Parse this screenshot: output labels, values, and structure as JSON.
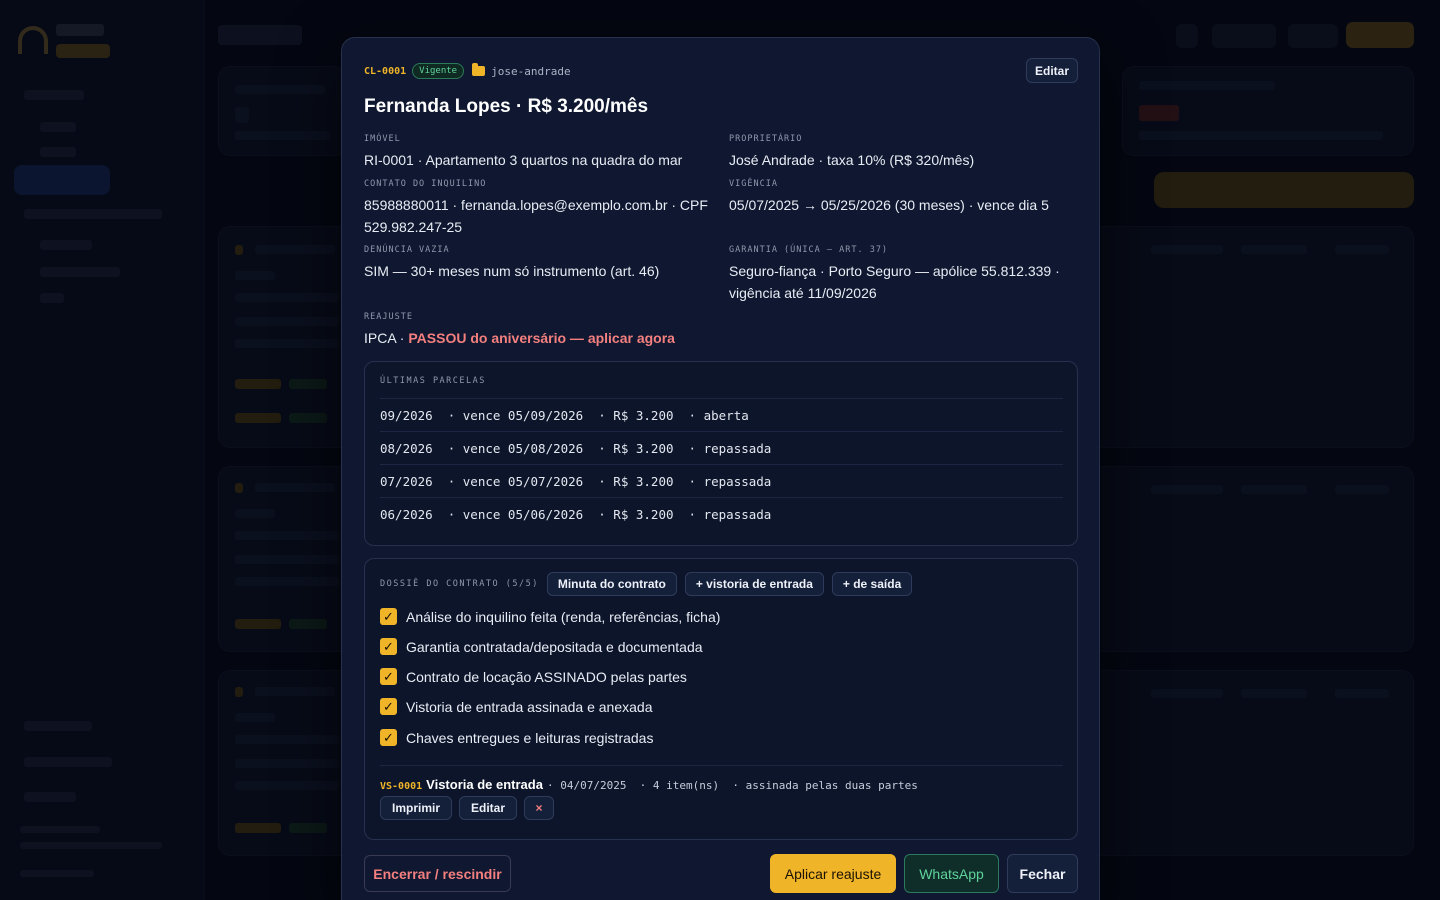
{
  "contract": {
    "code": "CL-0001",
    "status": "Vigente",
    "folder": "jose-andrade",
    "edit_label": "Editar",
    "title": "Fernanda Lopes · R$ 3.200/mês"
  },
  "fields": {
    "imovel": {
      "label": "Imóvel",
      "value": "RI-0001 · Apartamento 3 quartos na quadra do mar"
    },
    "proprietario": {
      "label": "Proprietário",
      "value": "José Andrade · taxa 10% (R$ 320/mês)"
    },
    "contato": {
      "label": "Contato do inquilino",
      "value": "85988880011 · fernanda.lopes@exemplo.com.br · CPF 529.982.247-25"
    },
    "vigencia": {
      "label": "Vigência",
      "value": "05/07/2025 → 05/25/2026 (30 meses) · vence dia 5"
    },
    "denuncia": {
      "label": "Denúncia vazia",
      "value": "SIM — 30+ meses num só instrumento (art. 46)"
    },
    "garantia": {
      "label": "Garantia (única — art. 37)",
      "value": "Seguro-fiança · Porto Seguro — apólice 55.812.339 · vigência até 11/09/2026"
    },
    "reajuste": {
      "label": "Reajuste",
      "value_prefix": "IPCA · ",
      "value_warning": "PASSOU do aniversário — aplicar agora"
    }
  },
  "parcels": {
    "label": "Últimas parcelas",
    "rows": [
      {
        "text": "09/2026  · vence 05/09/2026  · R$ 3.200  · aberta"
      },
      {
        "text": "08/2026  · vence 05/08/2026  · R$ 3.200  · repassada"
      },
      {
        "text": "07/2026  · vence 05/07/2026  · R$ 3.200  · repassada"
      },
      {
        "text": "06/2026  · vence 05/06/2026  · R$ 3.200  · repassada"
      }
    ]
  },
  "dossie": {
    "label": "Dossiê do contrato (5/5)",
    "chips": [
      "Minuta do contrato",
      "+ vistoria de entrada",
      "+ de saída"
    ],
    "items": [
      {
        "label": "Análise do inquilino feita (renda, referências, ficha)",
        "checked": true
      },
      {
        "label": "Garantia contratada/depositada e documentada",
        "checked": true
      },
      {
        "label": "Contrato de locação ASSINADO pelas partes",
        "checked": true
      },
      {
        "label": "Vistoria de entrada assinada e anexada",
        "checked": true
      },
      {
        "label": "Chaves entregues e leituras registradas",
        "checked": true
      }
    ],
    "vistoria": {
      "code": "VS-0001",
      "title": "Vistoria de entrada",
      "meta": "· 04/07/2025  · 4 item(ns)  · assinada pelas duas partes",
      "print_label": "Imprimir",
      "edit_label": "Editar",
      "remove_label": "×"
    }
  },
  "footer": {
    "terminate_label": "Encerrar / rescindir",
    "apply_label": "Aplicar reajuste",
    "whatsapp_label": "WhatsApp",
    "close_label": "Fechar"
  },
  "colors": {
    "accent": "#f0b429",
    "danger": "#f47f7f",
    "success": "#5fd39b",
    "modal_bg": "#0f1830"
  }
}
